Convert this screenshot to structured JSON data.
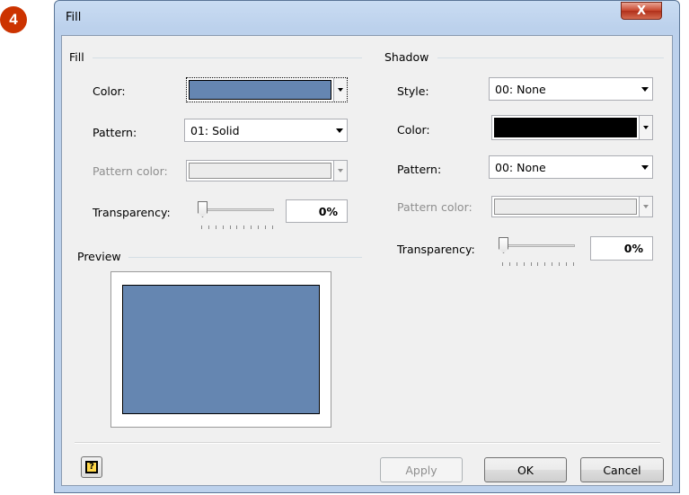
{
  "step_badge": "4",
  "window": {
    "title": "Fill",
    "close_glyph": "X"
  },
  "fill": {
    "group_label": "Fill",
    "color_label": "Color:",
    "color_value": "#6586b1",
    "pattern_label": "Pattern:",
    "pattern_value": "01: Solid",
    "pattern_color_label": "Pattern color:",
    "transparency_label": "Transparency:",
    "transparency_value": "0%",
    "transparency_fraction": 0
  },
  "preview": {
    "group_label": "Preview",
    "fill_color": "#6586b1"
  },
  "shadow": {
    "group_label": "Shadow",
    "style_label": "Style:",
    "style_value": "00: None",
    "color_label": "Color:",
    "color_value": "#000000",
    "pattern_label": "Pattern:",
    "pattern_value": "00: None",
    "pattern_color_label": "Pattern color:",
    "transparency_label": "Transparency:",
    "transparency_value": "0%",
    "transparency_fraction": 0
  },
  "buttons": {
    "help_glyph": "?",
    "apply": "Apply",
    "ok": "OK",
    "cancel": "Cancel"
  }
}
